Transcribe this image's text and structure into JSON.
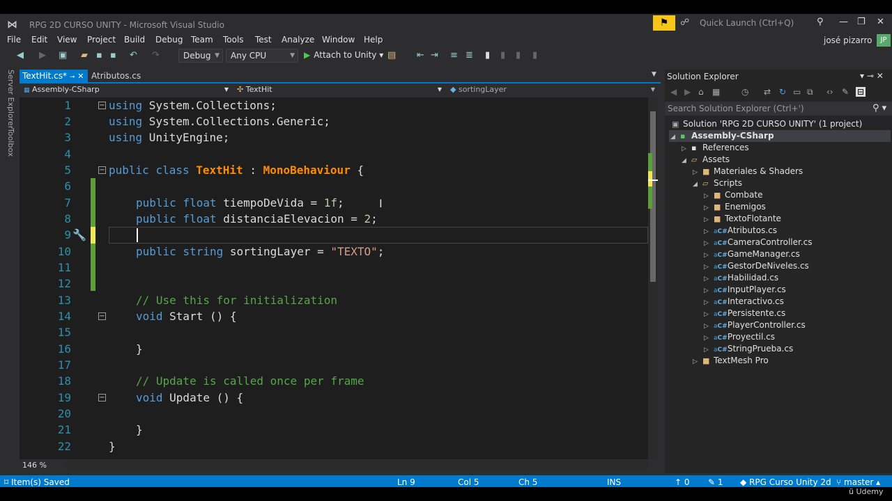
{
  "window": {
    "title": "RPG 2D CURSO UNITY - Microsoft Visual Studio",
    "quick_launch_placeholder": "Quick Launch (Ctrl+Q)",
    "user_name": "josé pizarro",
    "user_initials": "JP"
  },
  "menu": [
    "File",
    "Edit",
    "View",
    "Project",
    "Build",
    "Debug",
    "Team",
    "Tools",
    "Test",
    "Analyze",
    "Window",
    "Help"
  ],
  "toolbar": {
    "config": "Debug",
    "platform": "Any CPU",
    "attach_label": "Attach to Unity"
  },
  "side_tabs": [
    "Server Explorer",
    "Toolbox"
  ],
  "editor_tabs": [
    {
      "label": "TextHit.cs*",
      "active": true
    },
    {
      "label": "Atributos.cs",
      "active": false
    }
  ],
  "nav": {
    "project": "Assembly-CSharp",
    "class": "TextHit",
    "member": "sortingLayer"
  },
  "code": {
    "line_numbers": [
      "1",
      "2",
      "3",
      "4",
      "5",
      "6",
      "7",
      "8",
      "9",
      "10",
      "11",
      "12",
      "13",
      "14",
      "15",
      "16",
      "17",
      "18",
      "19",
      "20",
      "21",
      "22"
    ],
    "lines": {
      "l1": {
        "kw": "using",
        "rest": " System.Collections;"
      },
      "l2": {
        "kw": "using",
        "rest": " System.Collections.Generic;"
      },
      "l3": {
        "kw": "using",
        "rest": " UnityEngine;"
      },
      "l5": {
        "kw1": "public",
        "kw2": "class",
        "cls": "TextHit",
        "sep": " : ",
        "base": "MonoBehaviour",
        "rest": " {"
      },
      "l7": {
        "kw1": "public",
        "kw2": "float",
        "name": " tiempoDeVida = ",
        "num": "1f",
        "rest": ";"
      },
      "l8": {
        "kw1": "public",
        "kw2": "float",
        "name": " distanciaElevacion = ",
        "num": "2",
        "rest": ";"
      },
      "l10": {
        "kw1": "public",
        "kw2": "string",
        "name": " sortingLayer = ",
        "str": "\"TEXTO\"",
        "rest": ";"
      },
      "l13": {
        "comment": "// Use this for initialization"
      },
      "l14": {
        "kw": "void",
        "rest": " Start () {"
      },
      "l16": {
        "rest": "}"
      },
      "l18": {
        "comment": "// Update is called once per frame"
      },
      "l19": {
        "kw": "void",
        "rest": " Update () {"
      },
      "l21": {
        "rest": "}"
      },
      "l22": {
        "rest": "}"
      }
    },
    "zoom": "146 %"
  },
  "solution_explorer": {
    "title": "Solution Explorer",
    "search_placeholder": "Search Solution Explorer (Ctrl+')",
    "solution": "Solution 'RPG 2D CURSO UNITY' (1 project)",
    "project": "Assembly-CSharp",
    "references": "References",
    "assets": "Assets",
    "materiales": "Materiales & Shaders",
    "scripts": "Scripts",
    "folders": [
      "Combate",
      "Enemigos",
      "TextoFlotante"
    ],
    "files": [
      "Atributos.cs",
      "CameraController.cs",
      "GameManager.cs",
      "GestorDeNiveles.cs",
      "Habilidad.cs",
      "InputPlayer.cs",
      "Interactivo.cs",
      "Persistente.cs",
      "PlayerController.cs",
      "Proyectil.cs",
      "StringPrueba.cs"
    ],
    "textmesh": "TextMesh Pro"
  },
  "status": {
    "message": "Item(s) Saved",
    "ln": "Ln 9",
    "col": "Col 5",
    "ch": "Ch 5",
    "mode": "INS",
    "up_count": "0",
    "edit_count": "1",
    "repo": "RPG Curso Unity 2d",
    "branch": "master"
  },
  "watermark": "Udemy"
}
